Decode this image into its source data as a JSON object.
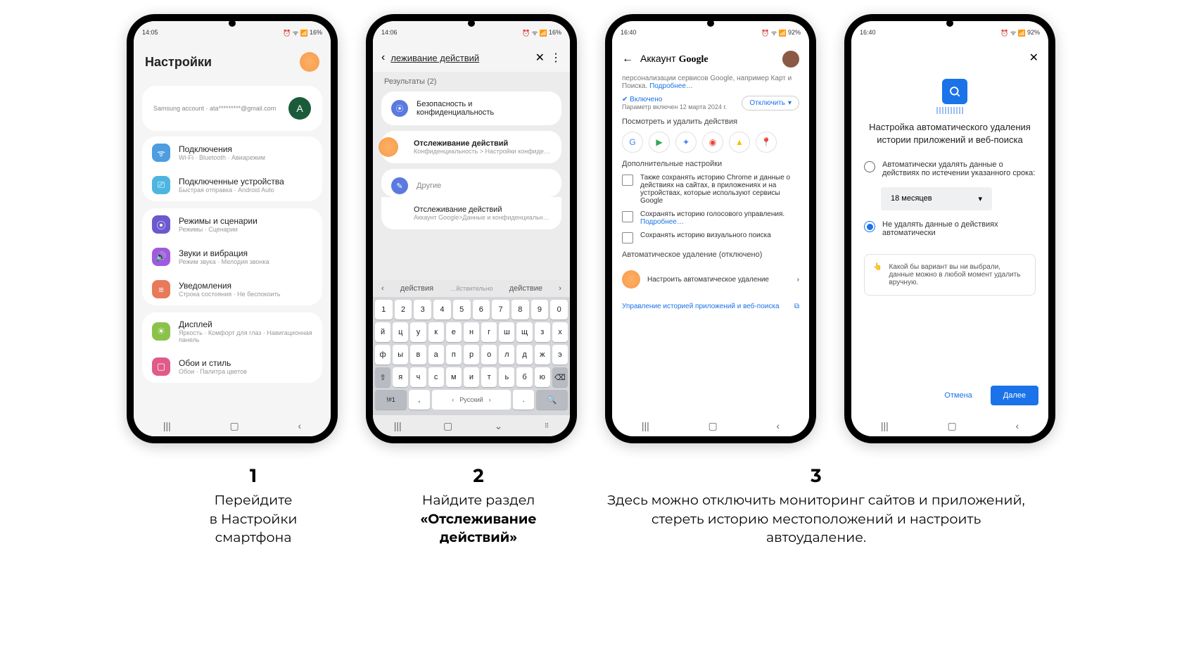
{
  "status": {
    "time1": "14:05",
    "time2": "14:06",
    "time3": "16:40",
    "time4": "16:40",
    "batt1": "16%",
    "batt3": "92%",
    "icons_left": "⬛◧▤",
    "icons_right": "⏰ ᯤ 📶"
  },
  "p1": {
    "title": "Настройки",
    "account_line": "Samsung account · ata*********@gmail.com",
    "avatar_letter": "A",
    "items": [
      {
        "title": "Подключения",
        "sub": "Wi-Fi · Bluetooth · Авиарежим",
        "color": "#4d9de0",
        "icon": "ᯤ"
      },
      {
        "title": "Подключенные устройства",
        "sub": "Быстрая отправка · Android Auto",
        "color": "#4db5e0",
        "icon": "⎚"
      },
      {
        "title": "Режимы и сценарии",
        "sub": "Режимы · Сценарии",
        "color": "#6a5acd",
        "icon": "⦿"
      },
      {
        "title": "Звуки и вибрация",
        "sub": "Режим звука · Мелодия звонка",
        "color": "#a05ae0",
        "icon": "🔊"
      },
      {
        "title": "Уведомления",
        "sub": "Строка состояния · Не беспокоить",
        "color": "#e87a5a",
        "icon": "≡"
      },
      {
        "title": "Дисплей",
        "sub": "Яркость · Комфорт для глаз · Навигационная панель",
        "color": "#8bc34a",
        "icon": "☀"
      },
      {
        "title": "Обои и стиль",
        "sub": "Обои · Палитра цветов",
        "color": "#e05a8a",
        "icon": "▢"
      }
    ]
  },
  "p2": {
    "search_text": "леживание действий",
    "results_label": "Результаты (2)",
    "r1": {
      "title": "Безопасность и конфиденциальность",
      "color": "#5a7ae0",
      "icon": "⦿"
    },
    "r2": {
      "title": "Отслеживание действий",
      "sub": "Конфиденциальность > Настройки конфиде…"
    },
    "r3_label": "Другие",
    "r3": {
      "title": "Отслеживание действий",
      "sub": "Аккаунт Google>Данные и конфиденциальн…",
      "color": "#5a7ae0",
      "icon": "✎"
    },
    "suggestions": [
      "‹",
      "действия",
      "…йствительно",
      "действие",
      "›"
    ],
    "kb_rows": [
      [
        "1",
        "2",
        "3",
        "4",
        "5",
        "6",
        "7",
        "8",
        "9",
        "0"
      ],
      [
        "й",
        "ц",
        "у",
        "к",
        "е",
        "н",
        "г",
        "ш",
        "щ",
        "з",
        "х"
      ],
      [
        "ф",
        "ы",
        "в",
        "а",
        "п",
        "р",
        "о",
        "л",
        "д",
        "ж",
        "э"
      ],
      [
        "⇧",
        "я",
        "ч",
        "с",
        "м",
        "и",
        "т",
        "ь",
        "б",
        "ю",
        "⌫"
      ]
    ],
    "kb_lang": "Русский",
    "kb_sym": "!#1"
  },
  "p3": {
    "header_text": "Аккаунт",
    "header_brand": "Google",
    "intro_text": "персонализации сервисов Google, например Карт и Поиска.",
    "intro_more": "Подробнее…",
    "enabled_label": "Включено",
    "enabled_sub": "Параметр включен 12 марта 2024 г.",
    "disable_btn": "Отключить",
    "view_delete": "Посмотреть и удалить действия",
    "apps": [
      "G",
      "▶",
      "✦",
      "◉",
      "▲",
      "📍"
    ],
    "app_colors": [
      "#4285f4",
      "#34a853",
      "#4285f4",
      "#ea4335",
      "#fbbc05",
      "#34a853"
    ],
    "extra_title": "Дополнительные настройки",
    "checks": [
      "Также сохранять историю Chrome и данные о действиях на сайтах, в приложениях и на устройствах, которые используют сервисы Google",
      "Сохранять историю голосового управления.",
      "Сохранять историю визуального поиска"
    ],
    "check2_more": "Подробнее…",
    "auto_title": "Автоматическое удаление (отключено)",
    "auto_row": "Настроить автоматическое удаление",
    "footer_link": "Управление историей приложений и веб-поиска"
  },
  "p4": {
    "title": "Настройка автоматического удаления истории приложений и веб-поиска",
    "opt1": "Автоматически удалять данные о действиях по истечении указанного срока:",
    "select_val": "18 месяцев",
    "opt2": "Не удалять данные о действиях автоматически",
    "note": "Какой бы вариант вы ни выбрали, данные можно в любой момент удалить вручную.",
    "cancel": "Отмена",
    "next": "Далее"
  },
  "captions": {
    "n1": "1",
    "t1a": "Перейдите",
    "t1b": "в Настройки",
    "t1c": "смартфона",
    "n2": "2",
    "t2a": "Найдите раздел",
    "t2b": "«Отслеживание действий»",
    "n3": "3",
    "t3": "Здесь можно отключить мониторинг сайтов и приложений, стереть историю местоположений и настроить автоудаление."
  }
}
